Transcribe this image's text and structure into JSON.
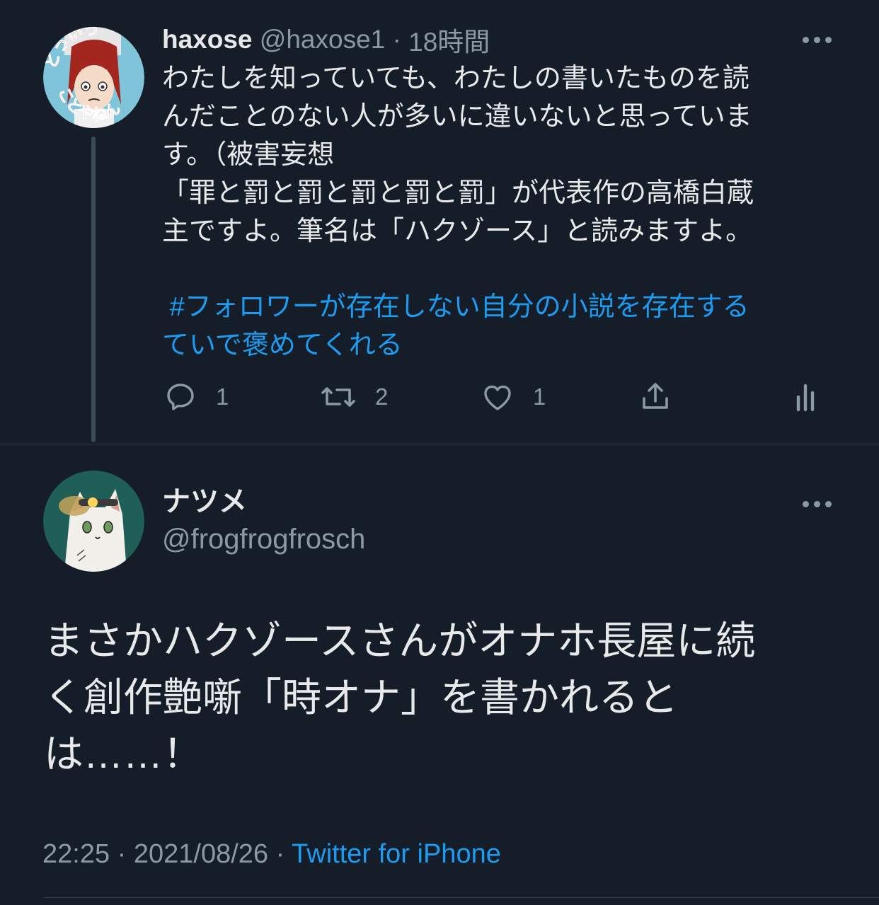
{
  "tweet1": {
    "display_name": "haxose",
    "handle": "@haxose1",
    "time_sep": " · ",
    "time": "18時間",
    "avatar_text": "どういうことやねん",
    "body": "わたしを知っていても、わたしの書いたものを読\nんだことのない人が多いに違いないと思っていま\nす。（被害妄想\n「罪と罰と罰と罰と罰と罰」が代表作の高橋白蔵\n主ですよ。筆名は「ハクゾース」と読みますよ。",
    "hashtag": " #フォロワーが存在しない自分の小説を存在する\nていで褒めてくれる",
    "actions": {
      "reply_count": "1",
      "retweet_count": "2",
      "like_count": "1"
    },
    "icons": [
      "more-icon",
      "reply-icon",
      "retweet-icon",
      "like-icon",
      "share-icon",
      "analytics-icon"
    ]
  },
  "tweet2": {
    "display_name": "ナツメ",
    "handle": "@frogfrogfrosch",
    "body": "まさかハクゾースさんがオナホ長屋に続\nく創作艶噺「時オナ」を書かれると\nは……！",
    "time": "22:25",
    "sep1": " · ",
    "date": "2021/08/26",
    "sep2": " · ",
    "source": "Twitter for iPhone"
  },
  "colors": {
    "background": "#151d28",
    "text": "#e7e9ea",
    "muted": "#8b98a5",
    "accent": "#1d9bf0",
    "thread_line": "#3d4a57"
  }
}
